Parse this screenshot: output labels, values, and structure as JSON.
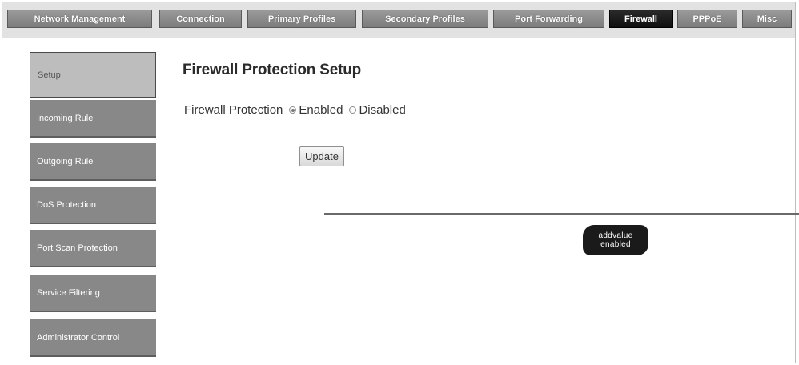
{
  "tabs": [
    {
      "label": "Network Management",
      "active": false
    },
    {
      "label": "Connection",
      "active": false
    },
    {
      "label": "Primary Profiles",
      "active": false
    },
    {
      "label": "Secondary Profiles",
      "active": false
    },
    {
      "label": "Port Forwarding",
      "active": false
    },
    {
      "label": "Firewall",
      "active": true
    },
    {
      "label": "PPPoE",
      "active": false
    },
    {
      "label": "Misc",
      "active": false
    }
  ],
  "sidebar": {
    "items": [
      {
        "label": "Setup",
        "active": true
      },
      {
        "label": "Incoming Rule",
        "active": false
      },
      {
        "label": "Outgoing Rule",
        "active": false
      },
      {
        "label": "DoS Protection",
        "active": false
      },
      {
        "label": "Port Scan Protection",
        "active": false
      },
      {
        "label": "Service Filtering",
        "active": false
      },
      {
        "label": "Administrator Control",
        "active": false
      }
    ]
  },
  "main": {
    "title": "Firewall Protection Setup",
    "firewall_label": "Firewall Protection",
    "options": [
      {
        "label": "Enabled",
        "checked": true
      },
      {
        "label": "Disabled",
        "checked": false
      }
    ],
    "update_label": "Update"
  },
  "footer": {
    "logo_line1": "addvalue",
    "logo_line2": "enabled"
  },
  "colors": {
    "tab_bg": "#8a8a8a",
    "tab_active_bg": "#1a1a1a",
    "sidebar_bg": "#888888",
    "sidebar_active_bg": "#bdbdbd"
  }
}
